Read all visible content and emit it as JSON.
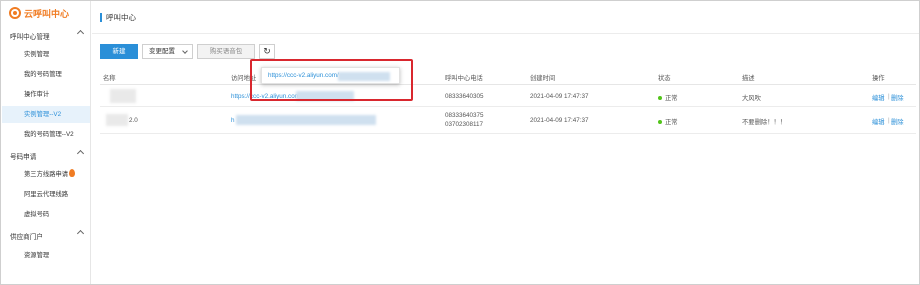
{
  "app": {
    "logo_text": "云呼叫中心"
  },
  "sidebar": {
    "groups": [
      {
        "title": "呼叫中心管理",
        "items": [
          "实例管理",
          "我的号码管理",
          "操作审计",
          "实例管理--V2",
          "我的号码管理--V2"
        ]
      },
      {
        "title": "号码申请",
        "items": [
          "第三方线路申请",
          "阿里云代理线路",
          "虚拟号码"
        ]
      },
      {
        "title": "供应商门户",
        "items": [
          "资源管理"
        ]
      }
    ],
    "active_item": "实例管理--V2"
  },
  "main": {
    "title": "呼叫中心",
    "toolbar": {
      "new_label": "新建",
      "change_config_label": "变更配置",
      "buy_voice_pkg_label": "购买语音包",
      "refresh_icon": "refresh-icon"
    },
    "table": {
      "headers": [
        "名称",
        "访问地址",
        "呼叫中心电话",
        "创建时间",
        "状态",
        "描述",
        "操作"
      ],
      "rows": [
        {
          "name": "",
          "url": "https://ccc-v2.aliyun.com/",
          "phones": [
            "08333640305"
          ],
          "created": "2021-04-09 17:47:37",
          "status": "正常",
          "description": "大风吹",
          "edit": "编辑",
          "delete": "删除"
        },
        {
          "name": "2.0",
          "url": "h",
          "phones": [
            "08333640375",
            "03702308117"
          ],
          "created": "2021-04-09 17:47:37",
          "status": "正常",
          "description": "不要删除！！！",
          "edit": "编辑",
          "delete": "删除"
        }
      ]
    },
    "tooltip": {
      "text": "https://ccc-v2.aliyun.com/"
    },
    "colors": {
      "accent": "#2a8fd8",
      "brand": "#f07c23",
      "highlight": "#d9272e",
      "status_ok": "#52c41a"
    }
  }
}
